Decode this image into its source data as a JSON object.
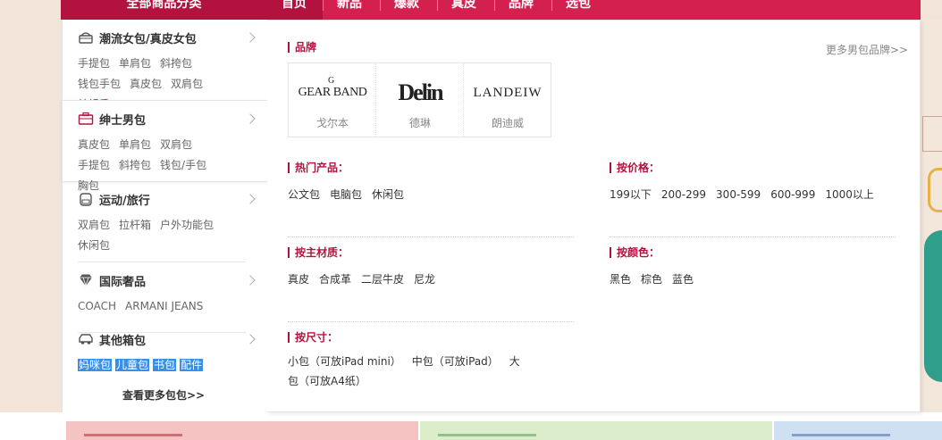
{
  "nav": {
    "all_categories": "全部商品分类",
    "links": [
      "首页",
      "新品",
      "爆款",
      "真皮",
      "品牌",
      "选包"
    ],
    "active_index": 0
  },
  "sidebar": {
    "categories": [
      {
        "title": "潮流女包/真皮女包",
        "icon": "handbag-icon",
        "links": [
          "手提包",
          "单肩包",
          "斜挎包",
          "钱包手包",
          "真皮包",
          "双肩包",
          "结婚季"
        ],
        "highlight": [
          "结婚季"
        ]
      },
      {
        "title": "绅士男包",
        "icon": "briefcase-icon",
        "links": [
          "真皮包",
          "单肩包",
          "双肩包",
          "手提包",
          "斜挎包",
          "钱包/手包",
          "胸包"
        ],
        "highlight": []
      },
      {
        "title": "运动/旅行",
        "icon": "backpack-icon",
        "links": [
          "双肩包",
          "拉杆箱",
          "户外功能包",
          "休闲包"
        ],
        "highlight": []
      },
      {
        "title": "国际奢品",
        "icon": "diamond-icon",
        "links": [
          "COACH",
          "ARMANI JEANS"
        ],
        "highlight": []
      },
      {
        "title": "其他箱包",
        "icon": "car-icon",
        "links": [
          "妈咪包",
          "儿童包",
          "书包",
          "配件"
        ],
        "highlight": []
      }
    ],
    "more_label": "查看更多包包>>"
  },
  "dropdown": {
    "brands_title": "品牌",
    "more_brands": "更多男包品牌>>",
    "brands": [
      {
        "logo": "GEAR BAND",
        "logo_mark": "G",
        "name": "戈尔本"
      },
      {
        "logo": "Delin",
        "name": "德琳"
      },
      {
        "logo": "LANDEIW",
        "name": "朗迪威"
      }
    ],
    "hot": {
      "title": "热门产品：",
      "items": [
        "公文包",
        "电脑包",
        "休闲包"
      ]
    },
    "price": {
      "title": "按价格：",
      "items": [
        "199以下",
        "200-299",
        "300-599",
        "600-999",
        "1000以上"
      ]
    },
    "material": {
      "title": "按主材质：",
      "items": [
        "真皮",
        "合成革",
        "二层牛皮",
        "尼龙"
      ]
    },
    "color": {
      "title": "按颜色：",
      "items": [
        "黑色",
        "棕色",
        "蓝色"
      ]
    },
    "size": {
      "title": "按尺寸：",
      "items": [
        "小包（可放iPad mini）",
        "中包（可放iPad）",
        "大包（可放A4纸）"
      ]
    }
  },
  "colors": {
    "accent": "#b4123e",
    "nav_bg": "#d4204f",
    "selection": "#3a8ee6"
  }
}
